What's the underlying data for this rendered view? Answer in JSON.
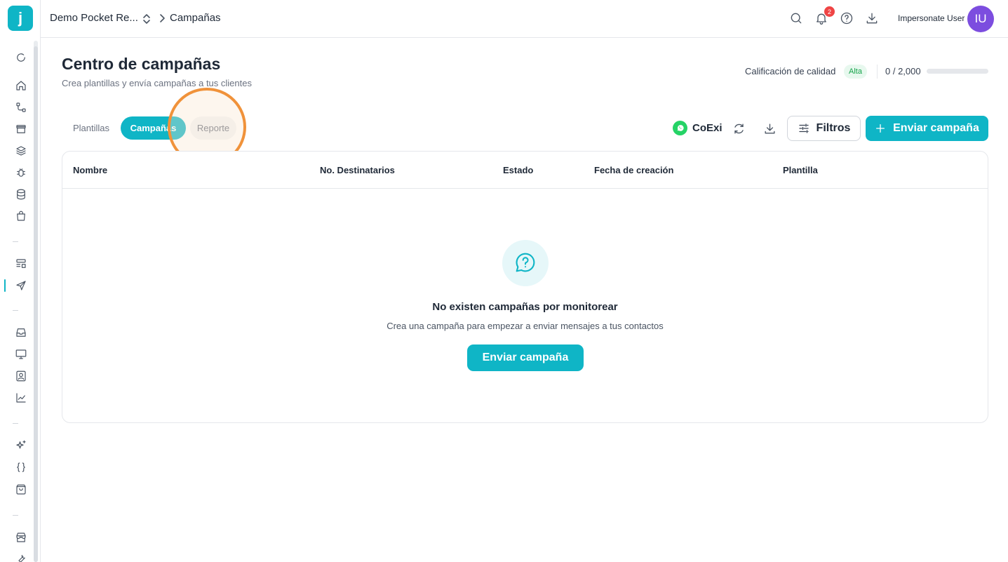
{
  "app": {
    "logo_letter": "j"
  },
  "header": {
    "org_name": "Demo Pocket Re...",
    "breadcrumb_current": "Campañas",
    "notification_count": "2",
    "user_name": "Impersonate User",
    "user_initials": "IU"
  },
  "sidebar": {
    "icons": [
      "refresh-icon",
      "home-icon",
      "flow-icon",
      "archive-icon",
      "layers-icon",
      "bug-icon",
      "database-icon",
      "bag-icon",
      "layout-icon",
      "send-icon",
      "inbox-icon",
      "monitor-icon",
      "contact-icon",
      "chart-icon",
      "sparkles-icon",
      "code-icon",
      "store-bag-icon",
      "shop-icon",
      "tools-icon"
    ],
    "active": "send-icon"
  },
  "page": {
    "title": "Centro de campañas",
    "subtitle": "Crea plantillas y envía campañas a tus clientes",
    "quality_label": "Calificación de calidad",
    "quality_value": "Alta",
    "quota_text": "0 / 2,000",
    "quota_fraction": 0
  },
  "tabs": [
    {
      "label": "Plantillas",
      "active": false
    },
    {
      "label": "Campañas",
      "active": true
    },
    {
      "label": "Reporte",
      "active": false
    }
  ],
  "toolbar": {
    "channel_name": "CoExi",
    "filters_label": "Filtros",
    "send_label": "Enviar campaña"
  },
  "table": {
    "columns": [
      "Nombre",
      "No. Destinatarios",
      "Estado",
      "Fecha de creación",
      "Plantilla"
    ]
  },
  "empty_state": {
    "title": "No existen campañas por monitorear",
    "description": "Crea una campaña para empezar a enviar mensajes a tus contactos",
    "button_label": "Enviar campaña"
  },
  "colors": {
    "accent": "#0fb5c6",
    "avatar": "#7c4ddf",
    "highlight": "#f0923a",
    "badge": "#ef4444"
  }
}
